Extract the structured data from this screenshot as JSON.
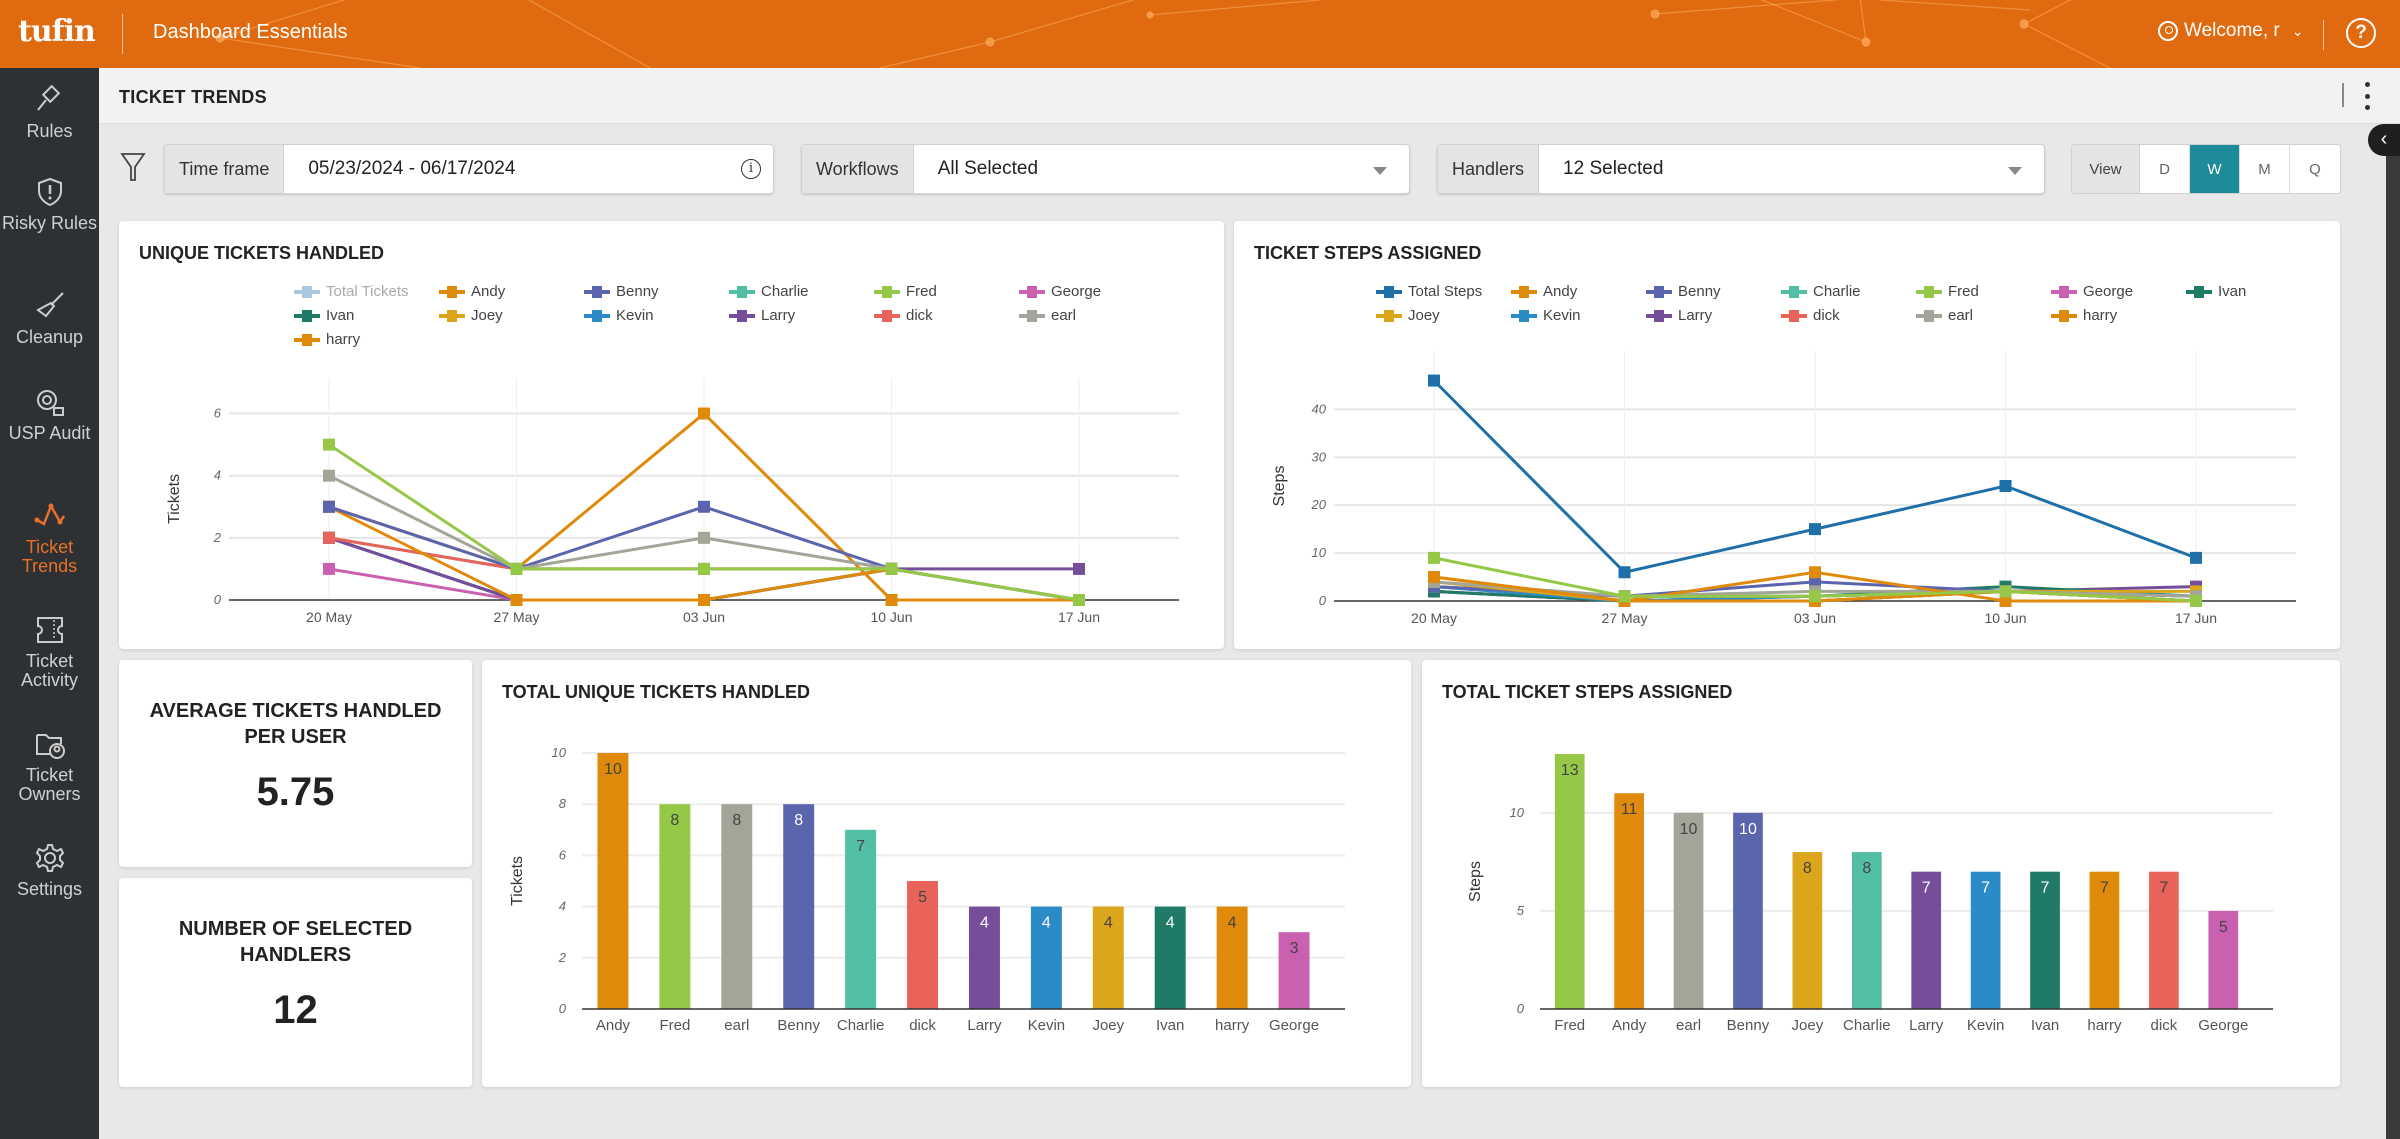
{
  "header": {
    "logo": "tufin",
    "app_title": "Dashboard Essentials",
    "welcome": "Welcome, r",
    "help_label": "?"
  },
  "sidebar": {
    "items": [
      {
        "label": "Rules",
        "icon": "gavel-icon",
        "active": false
      },
      {
        "label": "Risky Rules",
        "icon": "shield-alert-icon",
        "active": false
      },
      {
        "label": "Cleanup",
        "icon": "broom-icon",
        "active": false
      },
      {
        "label": "USP Audit",
        "icon": "audit-badge-icon",
        "active": false
      },
      {
        "label": "Ticket Trends",
        "icon": "trend-line-icon",
        "active": true
      },
      {
        "label": "Ticket Activity",
        "icon": "ticket-icon",
        "active": false
      },
      {
        "label": "Ticket Owners",
        "icon": "folder-user-icon",
        "active": false
      },
      {
        "label": "Settings",
        "icon": "gear-icon",
        "active": false
      }
    ]
  },
  "page": {
    "title": "TICKET TRENDS"
  },
  "filters": {
    "timeframe_label": "Time frame",
    "timeframe_value": "05/23/2024 - 06/17/2024",
    "workflows_label": "Workflows",
    "workflows_value": "All Selected",
    "handlers_label": "Handlers",
    "handlers_value": "12 Selected",
    "view_label": "View",
    "view_options": [
      "D",
      "W",
      "M",
      "Q"
    ],
    "view_selected": "W"
  },
  "stats": {
    "avg_label": "AVERAGE TICKETS HANDLED PER USER",
    "avg_value": "5.75",
    "handlers_label": "NUMBER OF SELECTED HANDLERS",
    "handlers_value": "12"
  },
  "colors": {
    "Total Tickets": "#a9c8e0",
    "Total Steps": "#1f6fa8",
    "Andy": "#e08a0b",
    "Benny": "#5b65ad",
    "Charlie": "#52bea3",
    "Fred": "#95c847",
    "George": "#c961b0",
    "Ivan": "#1f7a68",
    "Joey": "#dba61c",
    "Kevin": "#2b8bc6",
    "Larry": "#744d9b",
    "dick": "#e8645a",
    "earl": "#a2a597",
    "harry": "#e08a0b"
  },
  "chart_data": [
    {
      "id": "unique_tickets",
      "type": "line",
      "title": "UNIQUE TICKETS HANDLED",
      "xlabel": "",
      "ylabel": "Tickets",
      "categories": [
        "20 May",
        "27 May",
        "03 Jun",
        "10 Jun",
        "17 Jun"
      ],
      "ylim": [
        0,
        6.5
      ],
      "yticks": [
        0,
        2,
        4,
        6
      ],
      "grid": true,
      "legend_position": "top",
      "legend": [
        "Total Tickets",
        "Andy",
        "Benny",
        "Charlie",
        "Fred",
        "George",
        "Ivan",
        "Joey",
        "Kevin",
        "Larry",
        "dick",
        "earl",
        "harry"
      ],
      "hidden_series": [
        "Total Tickets"
      ],
      "series": [
        {
          "name": "Fred",
          "values": [
            5,
            1,
            1,
            1,
            0
          ]
        },
        {
          "name": "earl",
          "values": [
            4,
            1,
            2,
            1,
            0
          ]
        },
        {
          "name": "Benny",
          "values": [
            3,
            1,
            3,
            1,
            0
          ]
        },
        {
          "name": "Andy",
          "values": [
            3,
            1,
            6,
            0,
            0
          ]
        },
        {
          "name": "harry",
          "values": [
            3,
            0,
            0,
            1,
            0
          ]
        },
        {
          "name": "dick",
          "values": [
            2,
            1,
            1,
            1,
            0
          ]
        },
        {
          "name": "Larry",
          "values": [
            2,
            0,
            0,
            1,
            1
          ]
        },
        {
          "name": "Charlie",
          "values": [
            2,
            1,
            1,
            1,
            0
          ]
        },
        {
          "name": "Kevin",
          "values": [
            2,
            0,
            0,
            1,
            0
          ]
        },
        {
          "name": "Ivan",
          "values": [
            2,
            0,
            0,
            1,
            0
          ]
        },
        {
          "name": "Joey",
          "values": [
            2,
            0,
            0,
            1,
            0
          ]
        },
        {
          "name": "George",
          "values": [
            1,
            0,
            0,
            1,
            0
          ]
        }
      ]
    },
    {
      "id": "ticket_steps",
      "type": "line",
      "title": "TICKET STEPS ASSIGNED",
      "xlabel": "",
      "ylabel": "Steps",
      "categories": [
        "20 May",
        "27 May",
        "03 Jun",
        "10 Jun",
        "17 Jun"
      ],
      "ylim": [
        0,
        48
      ],
      "yticks": [
        0,
        10,
        20,
        30,
        40
      ],
      "grid": true,
      "legend_position": "top",
      "legend": [
        "Total Steps",
        "Andy",
        "Benny",
        "Charlie",
        "Fred",
        "George",
        "Ivan",
        "Joey",
        "Kevin",
        "Larry",
        "dick",
        "earl",
        "harry"
      ],
      "series": [
        {
          "name": "Total Steps",
          "values": [
            46,
            6,
            15,
            24,
            9
          ]
        },
        {
          "name": "Fred",
          "values": [
            9,
            1,
            1,
            2,
            0
          ]
        },
        {
          "name": "Andy",
          "values": [
            5,
            0,
            6,
            0,
            0
          ]
        },
        {
          "name": "harry",
          "values": [
            5,
            0,
            0,
            2,
            0
          ]
        },
        {
          "name": "earl",
          "values": [
            4,
            1,
            2,
            2,
            1
          ]
        },
        {
          "name": "Joey",
          "values": [
            4,
            0,
            0,
            2,
            2
          ]
        },
        {
          "name": "Benny",
          "values": [
            3,
            1,
            4,
            2,
            0
          ]
        },
        {
          "name": "Charlie",
          "values": [
            3,
            1,
            1,
            2,
            1
          ]
        },
        {
          "name": "dick",
          "values": [
            3,
            1,
            1,
            2,
            0
          ]
        },
        {
          "name": "Kevin",
          "values": [
            3,
            0,
            1,
            2,
            1
          ]
        },
        {
          "name": "Ivan",
          "values": [
            2,
            0,
            1,
            3,
            1
          ]
        },
        {
          "name": "Larry",
          "values": [
            2,
            0,
            0,
            2,
            3
          ]
        },
        {
          "name": "George",
          "values": [
            2,
            0,
            0,
            2,
            1
          ]
        }
      ]
    },
    {
      "id": "total_unique_tickets",
      "type": "bar",
      "title": "TOTAL UNIQUE TICKETS HANDLED",
      "xlabel": "",
      "ylabel": "Tickets",
      "categories": [
        "Andy",
        "Fred",
        "earl",
        "Benny",
        "Charlie",
        "dick",
        "Larry",
        "Kevin",
        "Joey",
        "Ivan",
        "harry",
        "George"
      ],
      "values": [
        10,
        8,
        8,
        8,
        7,
        5,
        4,
        4,
        4,
        4,
        4,
        3
      ],
      "ylim": [
        0,
        10
      ],
      "yticks": [
        0,
        2,
        4,
        6,
        8,
        10
      ],
      "grid": true
    },
    {
      "id": "total_ticket_steps",
      "type": "bar",
      "title": "TOTAL TICKET STEPS ASSIGNED",
      "xlabel": "",
      "ylabel": "Steps",
      "categories": [
        "Fred",
        "Andy",
        "earl",
        "Benny",
        "Joey",
        "Charlie",
        "Larry",
        "Kevin",
        "Ivan",
        "harry",
        "dick",
        "George"
      ],
      "values": [
        13,
        11,
        10,
        10,
        8,
        8,
        7,
        7,
        7,
        7,
        7,
        5
      ],
      "ylim": [
        0,
        13
      ],
      "yticks": [
        0,
        5,
        10
      ],
      "grid": true
    }
  ]
}
